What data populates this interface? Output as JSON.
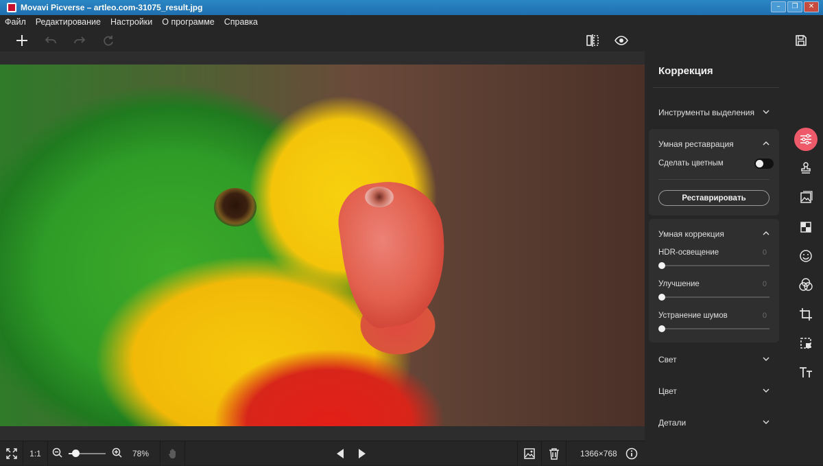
{
  "window": {
    "title": "Movavi Picverse – artleo.com-31075_result.jpg"
  },
  "menu": [
    "Файл",
    "Редактирование",
    "Настройки",
    "О программе",
    "Справка"
  ],
  "bottom": {
    "one_to_one": "1:1",
    "zoom_percent": "78%",
    "zoom_level": 0.18,
    "image_size": "1366×768"
  },
  "panel": {
    "title": "Коррекция",
    "selection_tools": "Инструменты выделения",
    "smart_restore": {
      "title": "Умная реставрация",
      "colorize_label": "Сделать цветным",
      "colorize_on": false,
      "restore_button": "Реставрировать"
    },
    "smart_correction": {
      "title": "Умная коррекция",
      "rows": [
        {
          "label": "HDR-освещение",
          "value": "0"
        },
        {
          "label": "Улучшение",
          "value": "0"
        },
        {
          "label": "Устранение шумов",
          "value": "0"
        }
      ]
    },
    "sections": [
      "Свет",
      "Цвет",
      "Детали"
    ]
  },
  "toolstrip": [
    "adjust-icon",
    "stamp-icon",
    "image-icon",
    "checker-icon",
    "smile-icon",
    "color-circles-icon",
    "crop-icon",
    "select-icon",
    "text-icon"
  ],
  "colors": {
    "accent": "#ef5a6a",
    "titlebar": "#1f6fae",
    "panel_bg": "#262626"
  }
}
